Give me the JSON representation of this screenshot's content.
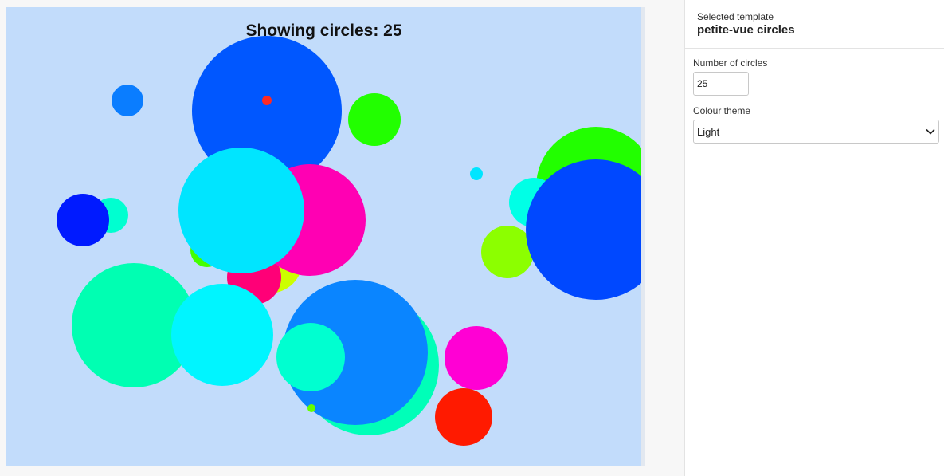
{
  "preview": {
    "heading": "Showing circles: 25"
  },
  "sidebar": {
    "template_caption": "Selected template",
    "template_name": "petite-vue circles",
    "count_label": "Number of circles",
    "count_value": "25",
    "theme_label": "Colour theme",
    "theme_value": "Light"
  },
  "colors": {
    "preview_background": "#c2dcfb",
    "sidebar_background": "#ffffff"
  },
  "icons": {
    "theme_dropdown": "chevron-down-icon"
  }
}
